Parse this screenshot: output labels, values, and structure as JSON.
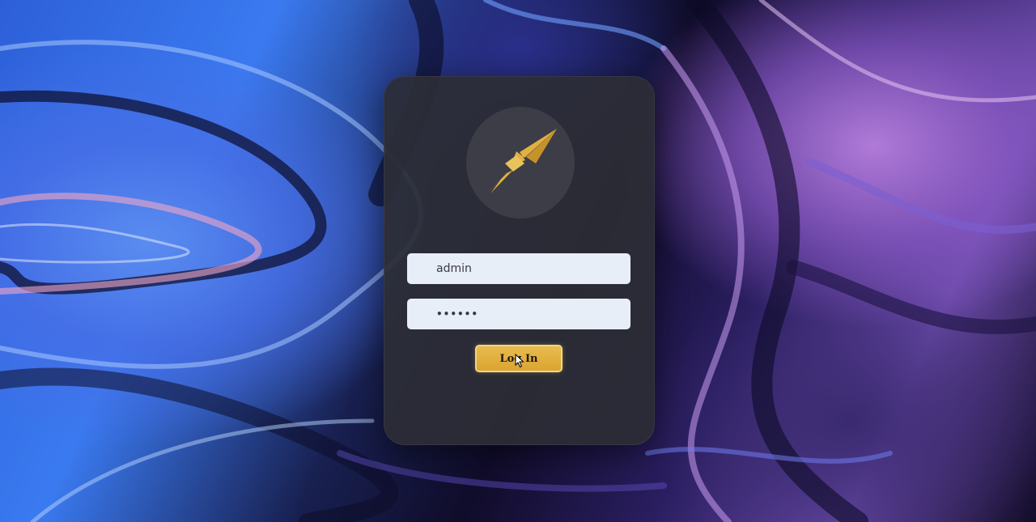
{
  "login": {
    "username_value": "admin",
    "password_value": "••••••",
    "login_label": "Log In"
  },
  "icons": {
    "logo": "rocket-logo-icon",
    "cursor": "mouse-pointer-icon"
  },
  "colors": {
    "card_bg": "#2c2d36",
    "logo_circle": "#3c3d46",
    "accent_gold": "#e0b042",
    "field_bg": "#e8eef7"
  }
}
